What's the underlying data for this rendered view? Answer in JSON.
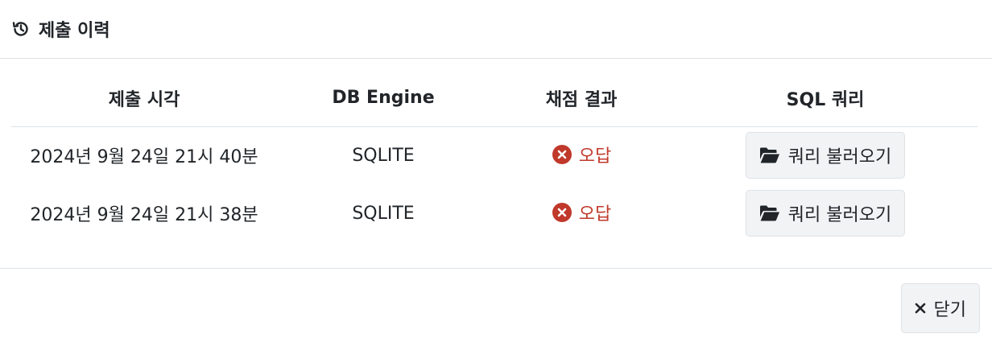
{
  "modal": {
    "title": "제출 이력",
    "title_icon": "history-icon"
  },
  "table": {
    "headers": {
      "time": "제출 시각",
      "engine": "DB Engine",
      "result": "채점 결과",
      "query": "SQL 쿼리"
    },
    "rows": [
      {
        "time": "2024년 9월 24일 21시 40분",
        "engine": "SQLITE",
        "result": "오답",
        "result_icon": "x-circle-icon",
        "query_button": "쿼리 불러오기",
        "query_button_icon": "folder-open-icon"
      },
      {
        "time": "2024년 9월 24일 21시 38분",
        "engine": "SQLITE",
        "result": "오답",
        "result_icon": "x-circle-icon",
        "query_button": "쿼리 불러오기",
        "query_button_icon": "folder-open-icon"
      }
    ]
  },
  "footer": {
    "close_label": "닫기",
    "close_icon": "close-icon"
  },
  "colors": {
    "wrong": "#c0392b",
    "border": "#dee2e6",
    "button_bg": "#f1f3f5",
    "text": "#212529"
  }
}
